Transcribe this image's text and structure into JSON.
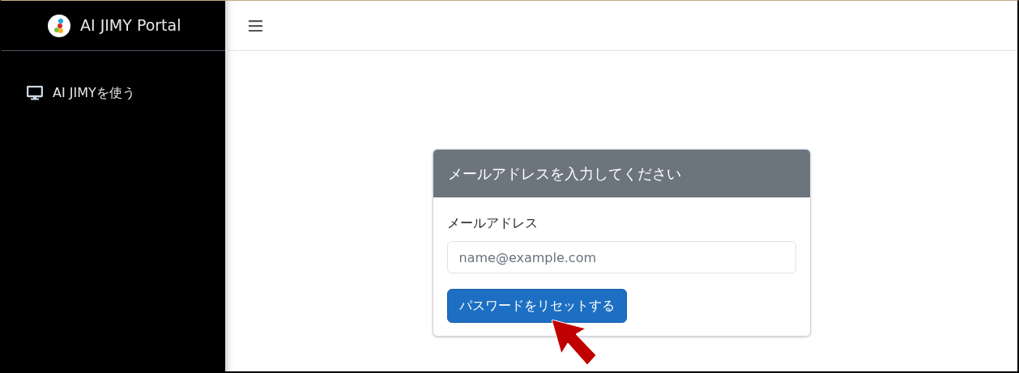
{
  "sidebar": {
    "brand": "AI JIMY Portal",
    "items": [
      {
        "label": "AI JIMYを使う"
      }
    ]
  },
  "card": {
    "title": "メールアドレスを入力してください",
    "field": {
      "label": "メールアドレス",
      "placeholder": "name@example.com"
    },
    "button": "パスワードをリセットする"
  }
}
